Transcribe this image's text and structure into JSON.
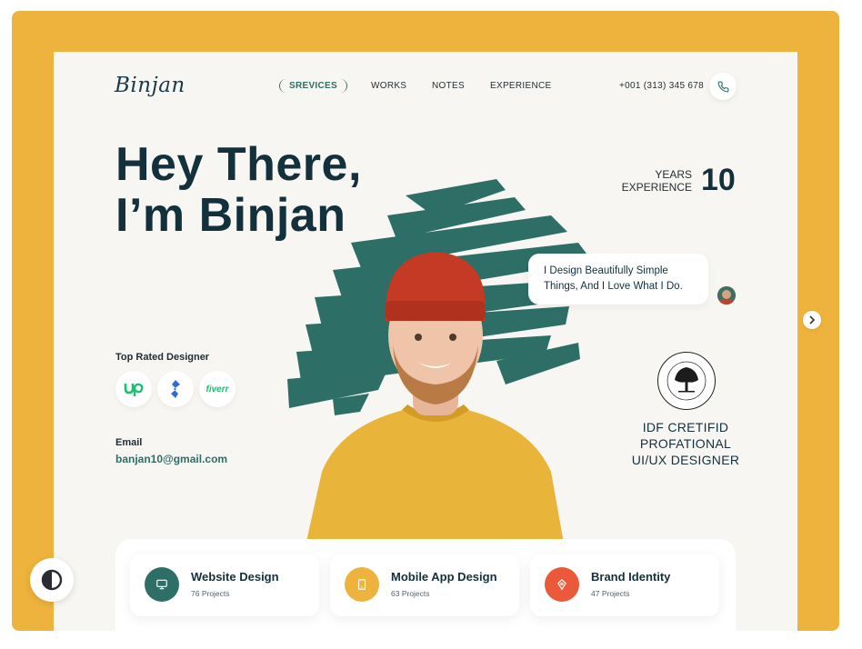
{
  "brand": {
    "logo": "Binjan"
  },
  "nav": {
    "items": [
      "SREVICES",
      "WORKS",
      "NOTES",
      "EXPERIENCE"
    ],
    "active": "SREVICES"
  },
  "contact": {
    "phone": "+001 (313) 345 678",
    "phone_icon": "phone-icon"
  },
  "hero": {
    "line1": "Hey There,",
    "line2": "I’m Binjan"
  },
  "experience": {
    "label_line1": "YEARS",
    "label_line2": "EXPERIENCE",
    "value": "10"
  },
  "bubble": {
    "line1": "I Design Beautifully Simple",
    "line2": "Things, And I Love What I Do."
  },
  "rated": {
    "title": "Top Rated Designer",
    "platforms": [
      "upwork-logo",
      "toptal-logo",
      "fiverr"
    ],
    "fiverr_label": "fiverr"
  },
  "email": {
    "label": "Email",
    "value": "banjan10@gmail.com"
  },
  "certification": {
    "line1": "IDF CRETIFID",
    "line2": "PROFATIONAL",
    "line3": "UI/UX DESIGNER"
  },
  "services": [
    {
      "title": "Website Design",
      "count": "76 Projects",
      "color": "#2D6E67",
      "icon": "monitor-icon"
    },
    {
      "title": "Mobile App Design",
      "count": "63 Projects",
      "color": "#EDB33C",
      "icon": "tablet-icon"
    },
    {
      "title": "Brand Identity",
      "count": "47 Projects",
      "color": "#E9593A",
      "icon": "pen-tool-icon"
    }
  ],
  "colors": {
    "frame": "#EDB33C",
    "card": "#F8F6F2",
    "accent_teal": "#2D6E67",
    "title_dark": "#13303D"
  }
}
